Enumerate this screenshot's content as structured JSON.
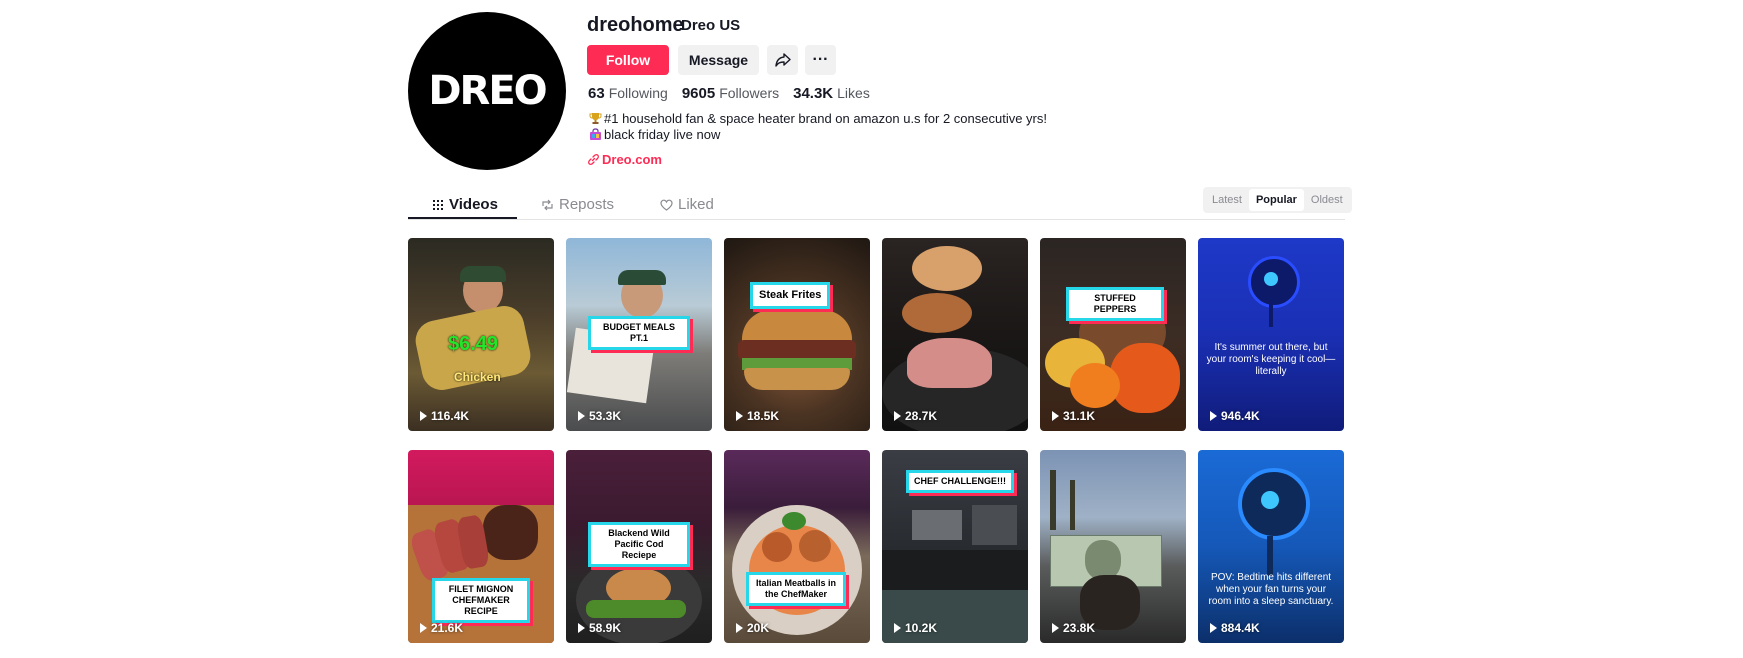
{
  "profile": {
    "avatar_text": "DREO",
    "username": "dreohome",
    "nickname": "Dreo US",
    "follow_label": "Follow",
    "message_label": "Message",
    "more_label": "···"
  },
  "stats": {
    "following_count": "63",
    "following_label": "Following",
    "followers_count": "9605",
    "followers_label": "Followers",
    "likes_count": "34.3K",
    "likes_label": "Likes"
  },
  "bio": {
    "line1_icon": "trophy-icon",
    "line1": "#1 household fan & space heater brand on amazon u.s for 2 consecutive yrs!",
    "line2_icon": "shopping-icon",
    "line2": "black friday live now"
  },
  "link": {
    "label": "Dreo.com"
  },
  "tabs": {
    "videos": "Videos",
    "reposts": "Reposts",
    "liked": "Liked"
  },
  "sort": {
    "options": [
      "Latest",
      "Popular",
      "Oldest"
    ],
    "selected": "Popular"
  },
  "videos": [
    {
      "views": "116.4K",
      "price": "$6.49",
      "subtitle": "Chicken"
    },
    {
      "views": "53.3K",
      "caption": "BUDGET MEALS PT.1"
    },
    {
      "views": "18.5K",
      "caption": "Steak Frites"
    },
    {
      "views": "28.7K"
    },
    {
      "views": "31.1K",
      "caption": "STUFFED PEPPERS"
    },
    {
      "views": "946.4K",
      "overlay": "It's summer out there, but your room's keeping it cool—literally"
    },
    {
      "views": "21.6K",
      "caption": "FILET MIGNON CHEFMAKER RECIPE"
    },
    {
      "views": "58.9K",
      "caption": "Blackend Wild Pacific Cod Reciepe"
    },
    {
      "views": "20K",
      "caption": "Italian Meatballs in the ChefMaker"
    },
    {
      "views": "10.2K",
      "caption": "CHEF CHALLENGE!!!"
    },
    {
      "views": "23.8K"
    },
    {
      "views": "884.4K",
      "overlay": "POV: Bedtime hits different when your fan turns your room into a sleep sanctuary."
    }
  ],
  "colors": {
    "accent": "#fe2c55",
    "caption_border": "#25d7e8"
  }
}
